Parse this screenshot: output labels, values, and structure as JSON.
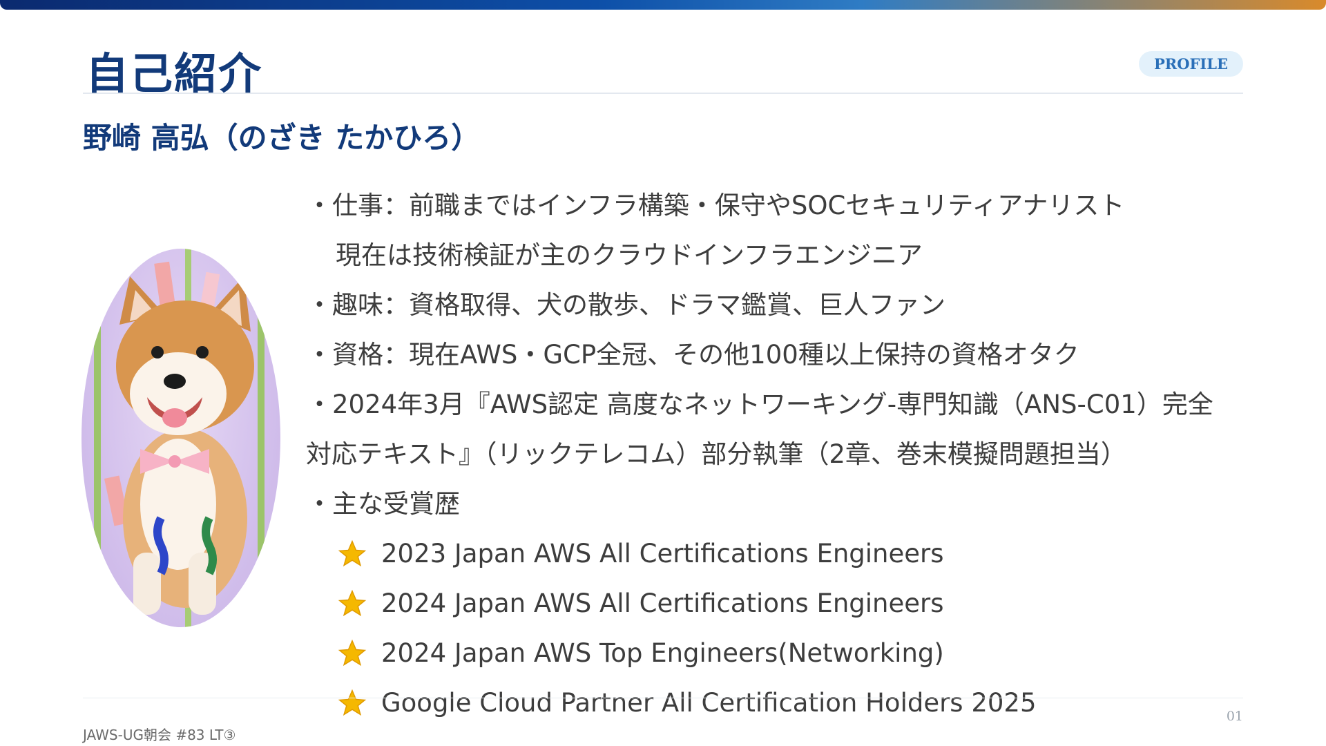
{
  "slide": {
    "title": "自己紹介",
    "badge": "PROFILE",
    "name": "野崎 高弘（のざき たかひろ）",
    "lines": [
      "・仕事：前職まではインフラ構築・保守やSOCセキュリティアナリスト",
      "現在は技術検証が主のクラウドインフラエンジニア",
      "・趣味：資格取得、犬の散歩、ドラマ鑑賞、巨人ファン",
      "・資格：現在AWS・GCP全冠、その他100種以上保持の資格オタク",
      "・2024年3月『AWS認定 高度なネットワーキング-専門知識（ANS-C01）完全",
      "対応テキスト』（リックテレコム）部分執筆（2章、巻末模擬問題担当）",
      "・主な受賞歴"
    ],
    "awards": [
      "2023 Japan AWS All Certifications Engineers",
      "2024 Japan AWS All Certifications Engineers",
      "2024 Japan AWS Top Engineers(Networking)",
      "Google Cloud Partner All Certification Holders 2025"
    ],
    "award_icon": "star-icon",
    "avatar_icon": "shiba-dog-photo",
    "footer": "JAWS-UG朝会 #83 LT③",
    "page_number": "01"
  },
  "colors": {
    "title": "#123a7a",
    "badge_text": "#2a6fb8",
    "badge_bg": "#e3f1fb",
    "body_text": "#3d3d3d",
    "star": "#f5b800"
  }
}
